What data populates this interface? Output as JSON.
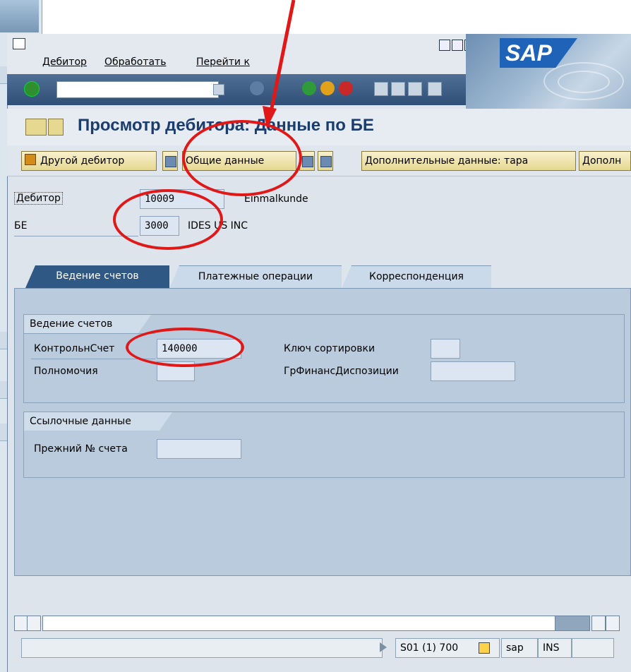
{
  "menu": {
    "items": [
      "Дебитор",
      "Обработать",
      "Перейти к"
    ]
  },
  "brand": {
    "logo": "SAP",
    "accent": "#1f63b8"
  },
  "toolbar": {
    "command_value": ""
  },
  "header": {
    "title": "Просмотр дебитора: Данные по БЕ"
  },
  "app_toolbar": {
    "other_debtor": "Другой дебитор",
    "general_data": "Общие данные",
    "additional_tara": "Дополнительные данные: тара",
    "additional_trunc": "Дополн"
  },
  "fields": {
    "debtor_label": "Дебитор",
    "debtor_value": "10009",
    "debtor_name": "Einmalkunde",
    "be_label": "БЕ",
    "be_value": "3000",
    "be_name": "IDES US INC"
  },
  "tabs": [
    "Ведение счетов",
    "Платежные операции",
    "Корреспонденция"
  ],
  "groups": {
    "accounts": {
      "title": "Ведение счетов",
      "control_label": "КонтрольнСчет",
      "control_value": "140000",
      "sort_label": "Ключ сортировки",
      "auth_label": "Полномочия",
      "finance_label": "ГрФинансДиспозиции"
    },
    "reference": {
      "title": "Ссылочные данные",
      "prev_label": "Прежний № счета"
    }
  },
  "status": {
    "system": "S01 (1) 700",
    "client": "sap",
    "mode": "INS"
  },
  "annotation": {
    "color": "#e01818"
  }
}
